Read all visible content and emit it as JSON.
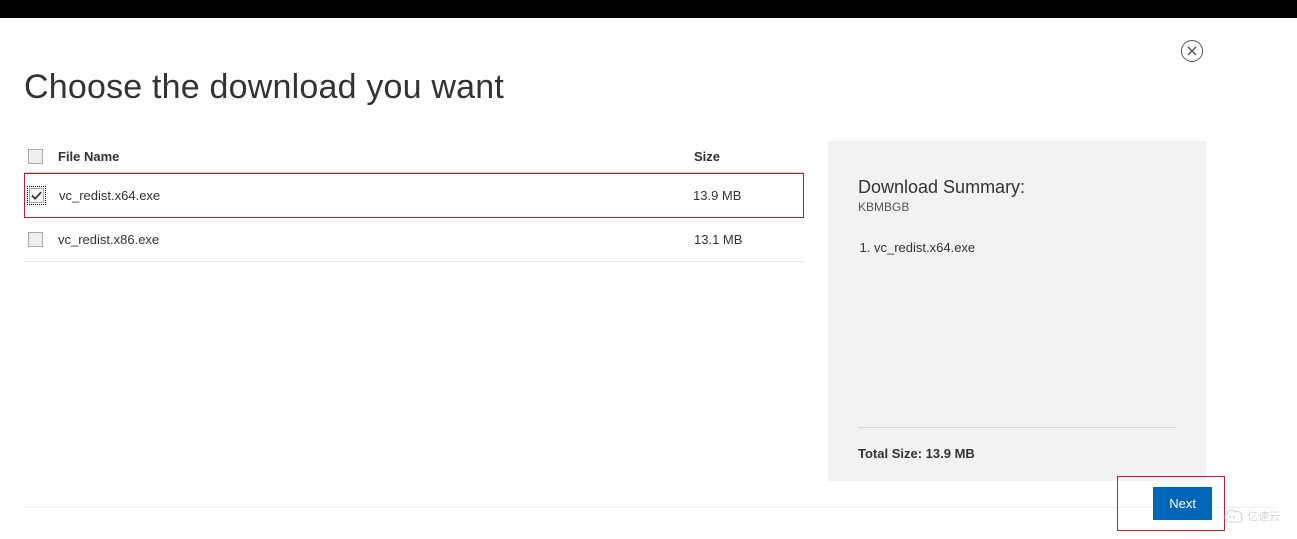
{
  "header": {
    "title": "Choose the download you want"
  },
  "table": {
    "header_filename": "File Name",
    "header_size": "Size",
    "rows": [
      {
        "name": "vc_redist.x64.exe",
        "size": "13.9 MB",
        "checked": true,
        "highlighted": true
      },
      {
        "name": "vc_redist.x86.exe",
        "size": "13.1 MB",
        "checked": false,
        "highlighted": false
      }
    ]
  },
  "summary": {
    "title": "Download Summary:",
    "subtitle": "KBMBGB",
    "items": [
      "vc_redist.x64.exe"
    ],
    "total_label": "Total Size:",
    "total_value": "13.9 MB"
  },
  "actions": {
    "next_label": "Next",
    "close_label": "Close"
  },
  "watermark": {
    "text": "亿速云"
  }
}
